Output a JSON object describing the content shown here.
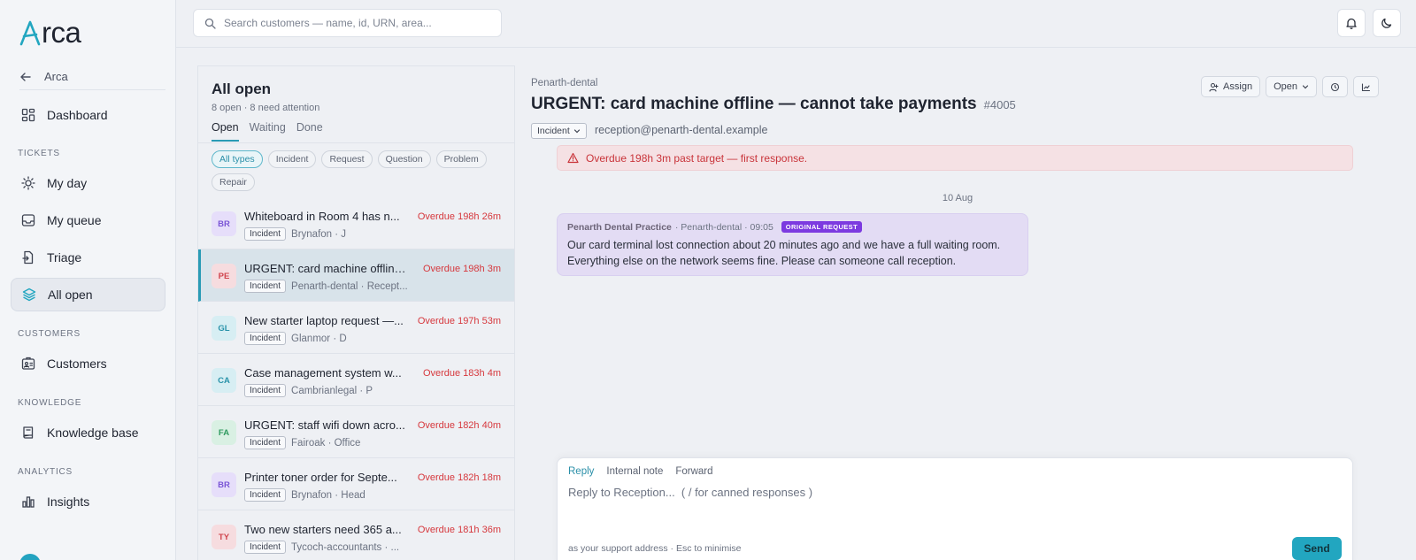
{
  "app": {
    "logo_text": "rca",
    "logo_letter": "A",
    "accent": "#22a6c0"
  },
  "sidebar": {
    "back_label": "Arca",
    "dashboard": "Dashboard",
    "sections": {
      "tickets": "TICKETS",
      "customers": "CUSTOMERS",
      "knowledge": "KNOWLEDGE",
      "analytics": "ANALYTICS"
    },
    "items": {
      "my_day": "My day",
      "my_queue": "My queue",
      "triage": "Triage",
      "all_open": "All open",
      "customers": "Customers",
      "knowledge_base": "Knowledge base",
      "insights": "Insights"
    }
  },
  "search": {
    "placeholder": "Search customers — name, id, URN, area..."
  },
  "list": {
    "title": "All open",
    "subtitle": "8 open · 8 need attention",
    "tabs": [
      "Open",
      "Waiting",
      "Done"
    ],
    "filters": [
      "All types",
      "Incident",
      "Request",
      "Question",
      "Problem",
      "Repair"
    ],
    "rows": [
      {
        "initials": "BR",
        "title": "Whiteboard in Room 4 has n...",
        "overdue": "Overdue 198h 26m",
        "type": "Incident",
        "org": "Brynafon · J",
        "avatar_bg": "#e6defa",
        "avatar_fg": "#7a55d6"
      },
      {
        "initials": "PE",
        "title": "URGENT: card machine offline ...",
        "overdue": "Overdue 198h 3m",
        "type": "Incident",
        "org": "Penarth-dental · Recept...",
        "avatar_bg": "#f6dcdf",
        "avatar_fg": "#d0454e"
      },
      {
        "initials": "GL",
        "title": "New starter laptop request —...",
        "overdue": "Overdue 197h 53m",
        "type": "Incident",
        "org": "Glanmor · D",
        "avatar_bg": "#d7eef3",
        "avatar_fg": "#2a93aa"
      },
      {
        "initials": "CA",
        "title": "Case management system w...",
        "overdue": "Overdue 183h 4m",
        "type": "Incident",
        "org": "Cambrianlegal · P",
        "avatar_bg": "#d7eef3",
        "avatar_fg": "#2a93aa"
      },
      {
        "initials": "FA",
        "title": "URGENT: staff wifi down acro...",
        "overdue": "Overdue 182h 40m",
        "type": "Incident",
        "org": "Fairoak · Office",
        "avatar_bg": "#d9f0e3",
        "avatar_fg": "#2f9a5f"
      },
      {
        "initials": "BR",
        "title": "Printer toner order for Septe...",
        "overdue": "Overdue 182h 18m",
        "type": "Incident",
        "org": "Brynafon · Head",
        "avatar_bg": "#e6defa",
        "avatar_fg": "#7a55d6"
      },
      {
        "initials": "TY",
        "title": "Two new starters need 365 a...",
        "overdue": "Overdue 181h 36m",
        "type": "Incident",
        "org": "Tycoch-accountants · ...",
        "avatar_bg": "#f6dcdf",
        "avatar_fg": "#d0454e"
      }
    ]
  },
  "ticket": {
    "breadcrumb": "Penarth-dental",
    "title": "URGENT: card machine offline — cannot take payments",
    "id": "#4005",
    "type": "Incident",
    "email": "reception@penarth-dental.example",
    "actions": {
      "assign": "Assign",
      "status": "Open"
    },
    "alert": "Overdue 198h 3m past target — first response.",
    "date": "10 Aug",
    "message": {
      "author": "Penarth Dental Practice",
      "meta": "· Penarth-dental · 09:05",
      "badge": "ORIGINAL REQUEST",
      "body": "Our card terminal lost connection about 20 minutes ago and we have a full waiting room. Everything else on the network seems fine. Please can someone call reception."
    }
  },
  "composer": {
    "tabs": [
      "Reply",
      "Internal note",
      "Forward"
    ],
    "placeholder": "Reply to Reception...  ( / for canned responses )",
    "hint": "as your support address · Esc to minimise",
    "send": "Send"
  }
}
